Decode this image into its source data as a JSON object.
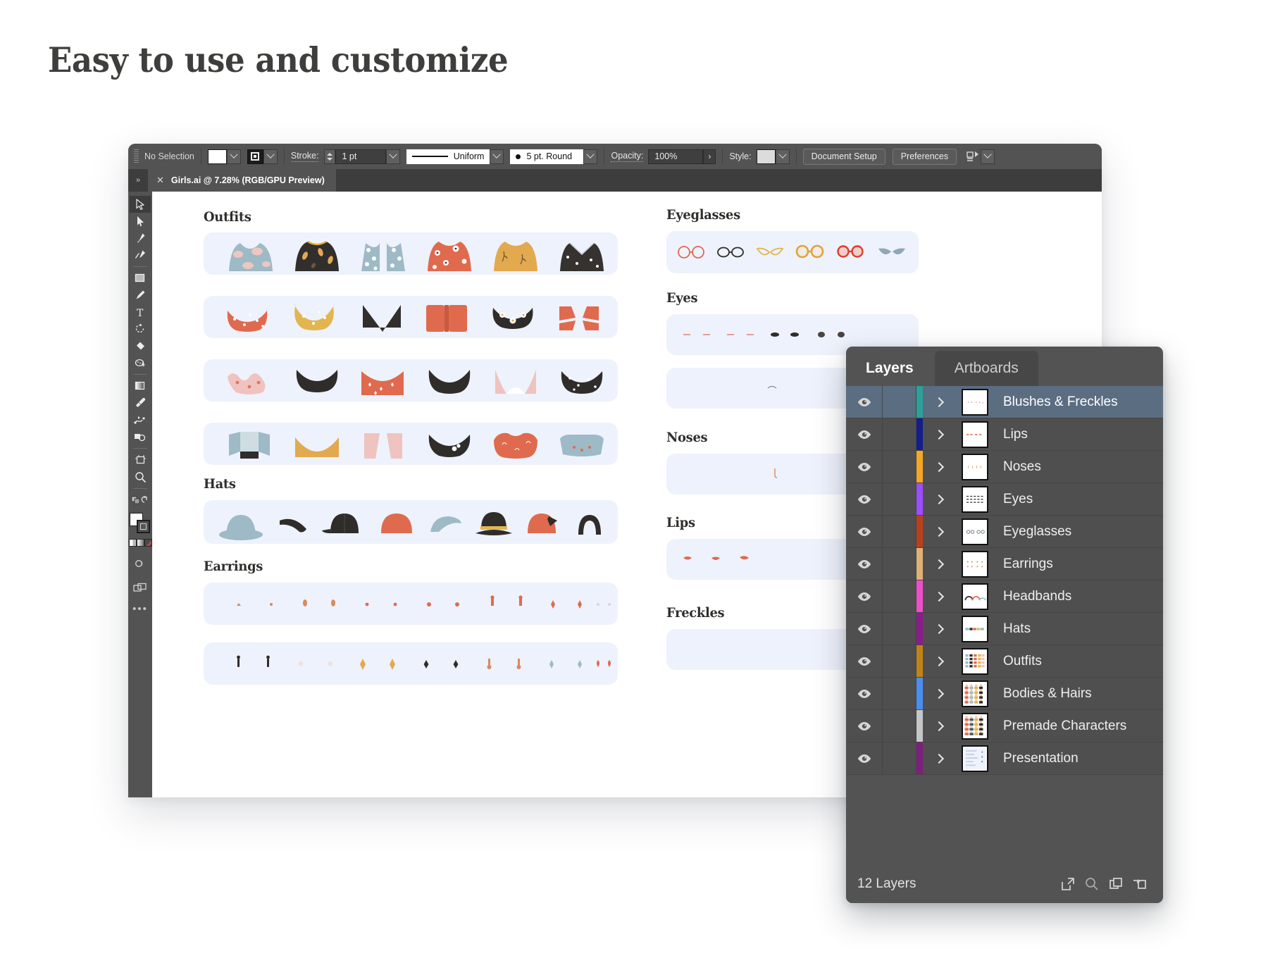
{
  "page": {
    "title": "Easy to use and customize"
  },
  "app": {
    "optionbar": {
      "selection_status": "No Selection",
      "stroke_label": "Stroke:",
      "stroke_value": "1 pt",
      "profile_label": "Uniform",
      "brush_label": "5 pt. Round",
      "opacity_label": "Opacity:",
      "opacity_value": "100%",
      "style_label": "Style:",
      "document_setup_label": "Document Setup",
      "preferences_label": "Preferences",
      "fill_color": "#ffffff",
      "stroke_color": "#1c1c1c"
    },
    "tabbar": {
      "document_tab": "Girls.ai @ 7.28% (RGB/GPU Preview)",
      "close_glyph": "✕",
      "expand_glyph": "»"
    },
    "tools": [
      {
        "name": "selection-tool",
        "selected": true
      },
      {
        "name": "direct-selection-tool",
        "selected": false
      },
      {
        "name": "pen-tool",
        "selected": false
      },
      {
        "name": "curvature-tool",
        "selected": false
      },
      {
        "name": "rectangle-tool",
        "selected": false
      },
      {
        "name": "paintbrush-tool",
        "selected": false
      },
      {
        "name": "type-tool",
        "selected": false
      },
      {
        "name": "rotate-tool",
        "selected": false
      },
      {
        "name": "eraser-tool",
        "selected": false
      },
      {
        "name": "shaper-tool",
        "selected": false
      },
      {
        "name": "gradient-tool",
        "selected": false
      },
      {
        "name": "eyedropper-tool",
        "selected": false
      },
      {
        "name": "blend-tool",
        "selected": false
      },
      {
        "name": "shape-builder-tool",
        "selected": false
      },
      {
        "name": "artboard-tool",
        "selected": false
      },
      {
        "name": "zoom-tool",
        "selected": false
      }
    ],
    "tool_footer": {
      "more_tools_glyph": "•••"
    }
  },
  "canvas": {
    "sections": [
      {
        "title": "Outfits"
      },
      {
        "title": "Hats"
      },
      {
        "title": "Earrings"
      },
      {
        "title": "Eyeglasses"
      },
      {
        "title": "Eyes"
      },
      {
        "title": "Noses"
      },
      {
        "title": "Lips"
      },
      {
        "title": "Freckles"
      }
    ],
    "row_bg": "#eef2fc"
  },
  "layers_panel": {
    "tabs": [
      {
        "label": "Layers",
        "active": true
      },
      {
        "label": "Artboards",
        "active": false
      }
    ],
    "layers": [
      {
        "name": "Blushes & Freckles",
        "color": "#2aa198",
        "visible": true,
        "selected": true
      },
      {
        "name": "Lips",
        "color": "#141e8c",
        "visible": true,
        "selected": false
      },
      {
        "name": "Noses",
        "color": "#f5a623",
        "visible": true,
        "selected": false
      },
      {
        "name": "Eyes",
        "color": "#9b4dff",
        "visible": true,
        "selected": false
      },
      {
        "name": "Eyeglasses",
        "color": "#b8411b",
        "visible": true,
        "selected": false
      },
      {
        "name": "Earrings",
        "color": "#e0b177",
        "visible": true,
        "selected": false
      },
      {
        "name": "Headbands",
        "color": "#ef4ecb",
        "visible": true,
        "selected": false
      },
      {
        "name": "Hats",
        "color": "#8c1b8c",
        "visible": true,
        "selected": false
      },
      {
        "name": "Outfits",
        "color": "#c08416",
        "visible": true,
        "selected": false
      },
      {
        "name": "Bodies & Hairs",
        "color": "#4a8ef0",
        "visible": true,
        "selected": false
      },
      {
        "name": "Premade Characters",
        "color": "#c6c6c6",
        "visible": true,
        "selected": false
      },
      {
        "name": "Presentation",
        "color": "#7d1f7d",
        "visible": true,
        "selected": false
      }
    ],
    "footer": {
      "count_label": "12 Layers",
      "icons": [
        "locate-object-icon",
        "search-layers-icon",
        "new-layer-icon",
        "delete-layer-icon"
      ]
    }
  }
}
